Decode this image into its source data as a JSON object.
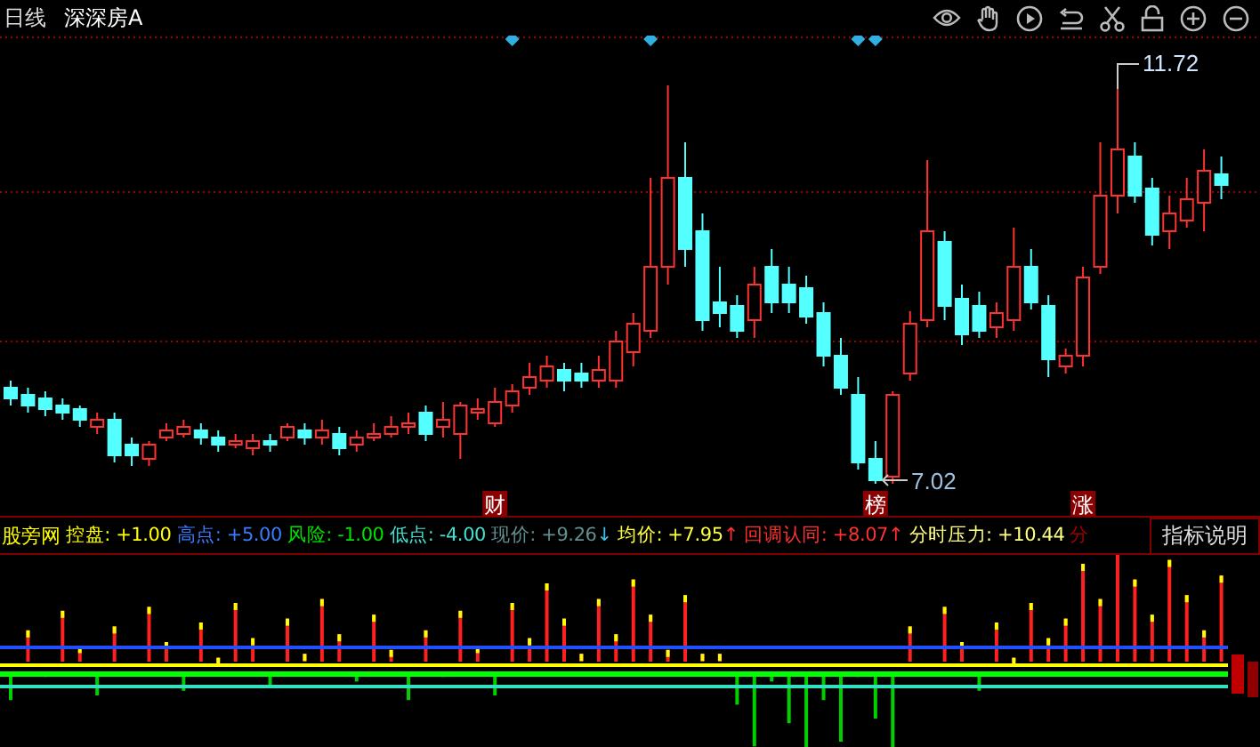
{
  "header": {
    "period": "日线",
    "stock_name": "深深房A"
  },
  "main_chart": {
    "high_label": "11.72",
    "low_label": "7.02",
    "event_markers": [
      {
        "label": "财"
      },
      {
        "label": "榜"
      },
      {
        "label": "涨"
      }
    ]
  },
  "indicator": {
    "name": "股旁网",
    "items": [
      {
        "label": "控盘:",
        "value": "+1.00",
        "color": "#ffff00"
      },
      {
        "label": "高点:",
        "value": "+5.00",
        "color": "#3a7cff"
      },
      {
        "label": "风险:",
        "value": "-1.00",
        "color": "#00e000"
      },
      {
        "label": "低点:",
        "value": "-4.00",
        "color": "#40e0d0"
      },
      {
        "label": "现价:",
        "value": "+9.26",
        "color": "#5f8f8f",
        "arrow": {
          "text": "↓",
          "color": "#40c0e0"
        }
      },
      {
        "label": "均价:",
        "value": "+7.95",
        "color": "#ffff40",
        "arrow": {
          "text": "↑",
          "color": "#ff3030"
        }
      },
      {
        "label": "回调认同:",
        "value": "+8.07",
        "color": "#ff3030",
        "arrow": {
          "text": "↑",
          "color": "#ff3030"
        }
      },
      {
        "label": "分时压力:",
        "value": "+10.44",
        "color": "#ffff80"
      },
      {
        "label": "分",
        "value": "",
        "color": "#a00000"
      }
    ],
    "button": "指标说明"
  }
}
